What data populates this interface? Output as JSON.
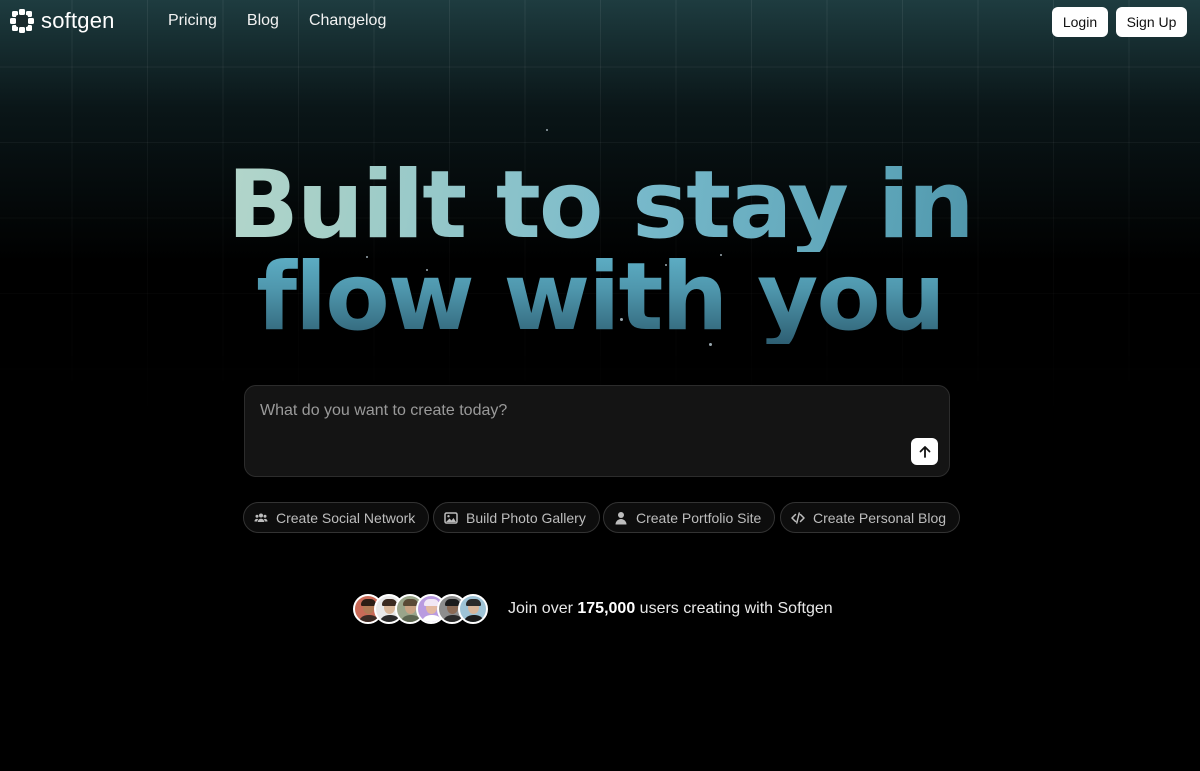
{
  "brand": {
    "name": "softgen"
  },
  "nav": {
    "links": [
      "Pricing",
      "Blog",
      "Changelog"
    ],
    "login_label": "Login",
    "signup_label": "Sign Up"
  },
  "hero": {
    "line1": "Built to stay in",
    "line2": "flow with you"
  },
  "prompt": {
    "placeholder": "What do you want to create today?",
    "value": ""
  },
  "suggestions": [
    {
      "label": "Create Social Network",
      "icon": "users-icon"
    },
    {
      "label": "Build Photo Gallery",
      "icon": "image-icon"
    },
    {
      "label": "Create Portfolio Site",
      "icon": "user-icon"
    },
    {
      "label": "Create Personal Blog",
      "icon": "code-icon"
    }
  ],
  "social_proof": {
    "prefix": "Join over ",
    "count": "175,000",
    "suffix": " users creating with Softgen",
    "avatar_count": 6
  },
  "colors": {
    "background": "#000000",
    "accent": "#5aa2b6",
    "button_bg": "#ffffff"
  }
}
